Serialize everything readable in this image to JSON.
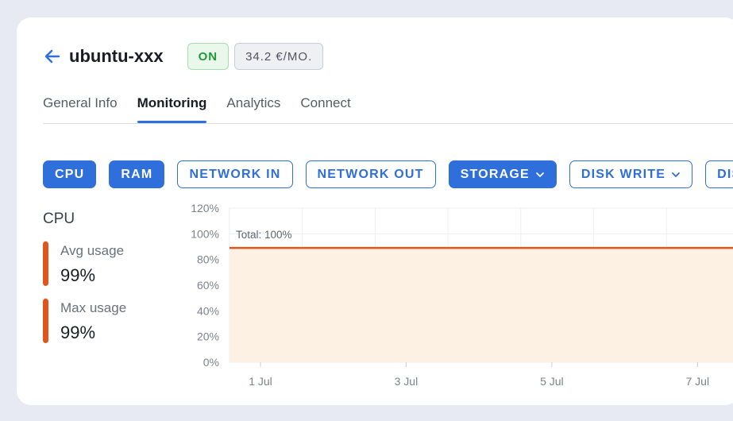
{
  "header": {
    "title": "ubuntu-xxx",
    "status": "ON",
    "price": "34.2 €/MO."
  },
  "tabs": [
    {
      "label": "General Info"
    },
    {
      "label": "Monitoring"
    },
    {
      "label": "Analytics"
    },
    {
      "label": "Connect"
    }
  ],
  "metrics": [
    {
      "label": "CPU"
    },
    {
      "label": "RAM"
    },
    {
      "label": "NETWORK IN"
    },
    {
      "label": "NETWORK OUT"
    },
    {
      "label": "STORAGE"
    },
    {
      "label": "DISK WRITE"
    },
    {
      "label": "DIS"
    }
  ],
  "side": {
    "title": "CPU",
    "avg": {
      "label": "Avg usage",
      "value": "99%",
      "level": 0.99
    },
    "max": {
      "label": "Max usage",
      "value": "99%",
      "level": 0.99
    }
  },
  "colors": {
    "accent": "#2f6fdc",
    "series": "#e0551c",
    "area": "#fdf0e3",
    "on_green": "#1d9b35"
  },
  "chart_data": {
    "type": "area",
    "y_ticks": [
      "0%",
      "20%",
      "40%",
      "60%",
      "80%",
      "100%",
      "120%"
    ],
    "ylim": [
      0,
      120
    ],
    "x_ticks": [
      "1 Jul",
      "3 Jul",
      "5 Jul",
      "7 Jul"
    ],
    "x": [
      1,
      2,
      3,
      4,
      5,
      6,
      7,
      8
    ],
    "series": [
      {
        "values": [
          89,
          89,
          89,
          89,
          89,
          89,
          89,
          89
        ]
      }
    ],
    "annotation": "Total: 100%",
    "grid": true
  }
}
